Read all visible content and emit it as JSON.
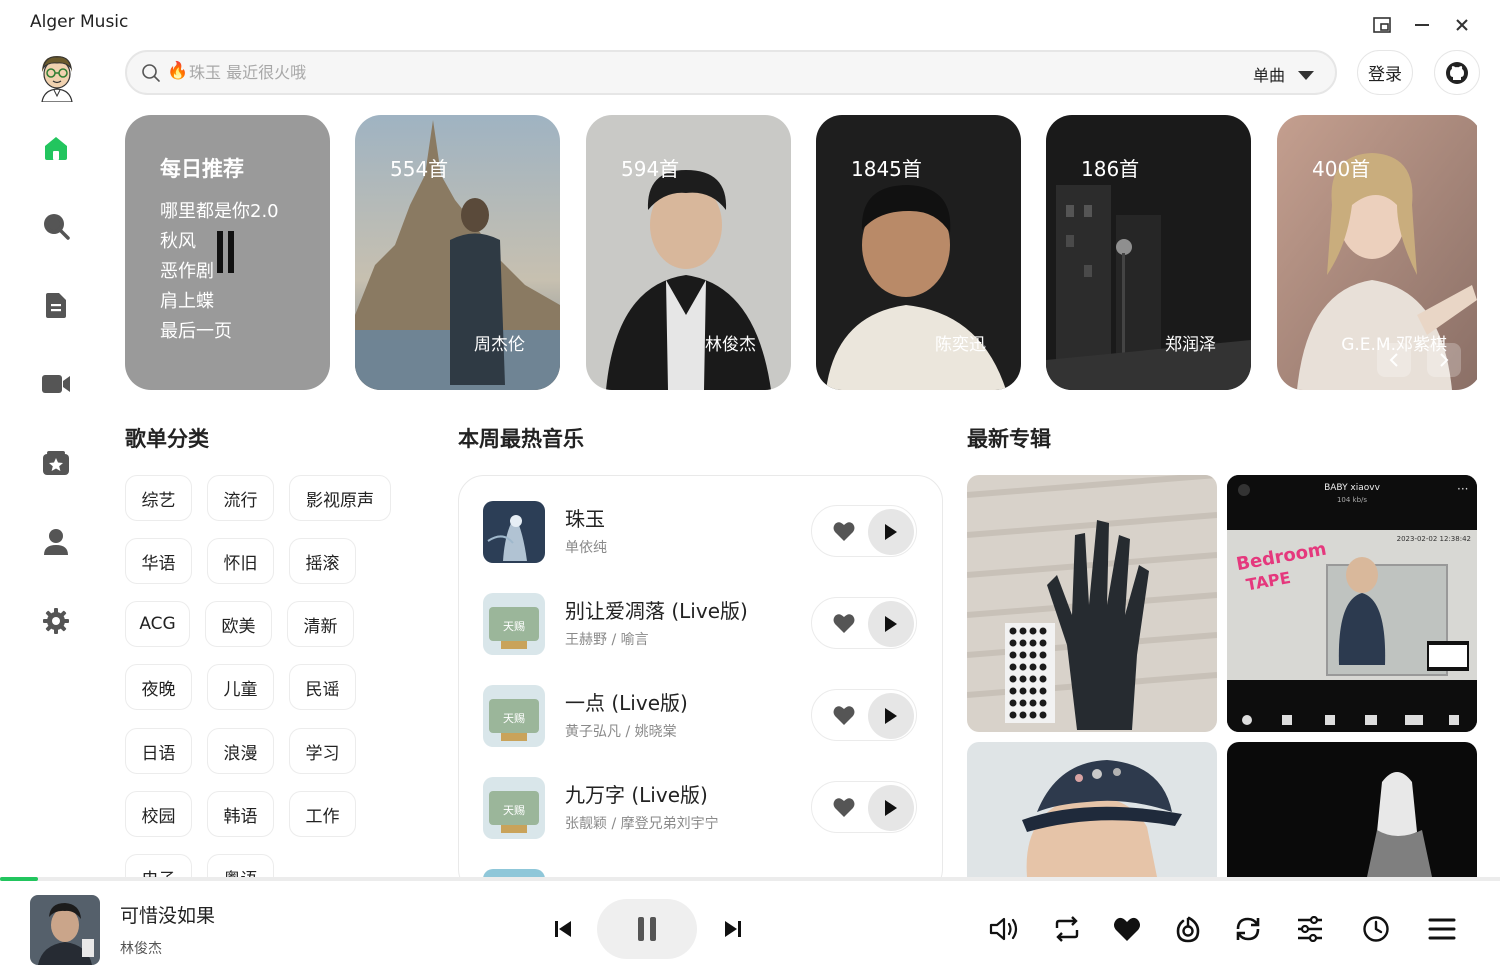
{
  "app": {
    "title": "Alger Music"
  },
  "search": {
    "placeholder": "珠玉 最近很火哦",
    "type_label": "单曲"
  },
  "header": {
    "login_label": "登录"
  },
  "daily": {
    "title": "每日推荐",
    "items": [
      "哪里都是你2.0",
      "秋风",
      "恶作剧",
      "肩上蝶",
      "最后一页"
    ]
  },
  "artists": [
    {
      "count": "554首",
      "name": "周杰伦"
    },
    {
      "count": "594首",
      "name": "林俊杰"
    },
    {
      "count": "1845首",
      "name": "陈奕迅"
    },
    {
      "count": "186首",
      "name": "郑润泽"
    },
    {
      "count": "400首",
      "name": "G.E.M.邓紫棋"
    }
  ],
  "sections": {
    "categories": "歌单分类",
    "hot": "本周最热音乐",
    "albums": "最新专辑"
  },
  "categories": [
    "综艺",
    "流行",
    "影视原声",
    "华语",
    "怀旧",
    "摇滚",
    "ACG",
    "欧美",
    "清新",
    "夜晚",
    "儿童",
    "民谣",
    "日语",
    "浪漫",
    "学习",
    "校园",
    "韩语",
    "工作",
    "电子",
    "粤语"
  ],
  "hot_songs": [
    {
      "name": "珠玉",
      "artist": "单依纯"
    },
    {
      "name": "别让爱凋落 (Live版)",
      "artist": "王赫野 / 喻言"
    },
    {
      "name": "一点 (Live版)",
      "artist": "黄子弘凡 / 姚晓棠"
    },
    {
      "name": "九万字 (Live版)",
      "artist": "张靓颖 / 摩登兄弟刘宇宁"
    }
  ],
  "albums": {
    "album2_title": "BABY xiaovv",
    "album2_sub": "104 kb/s",
    "album2_time": "2023-02-02  12:38:42"
  },
  "player": {
    "title": "可惜没如果",
    "artist": "林俊杰",
    "progress": 0.025
  },
  "colors": {
    "accent": "#22c55e",
    "daily_bg": "#9a9a9a"
  }
}
